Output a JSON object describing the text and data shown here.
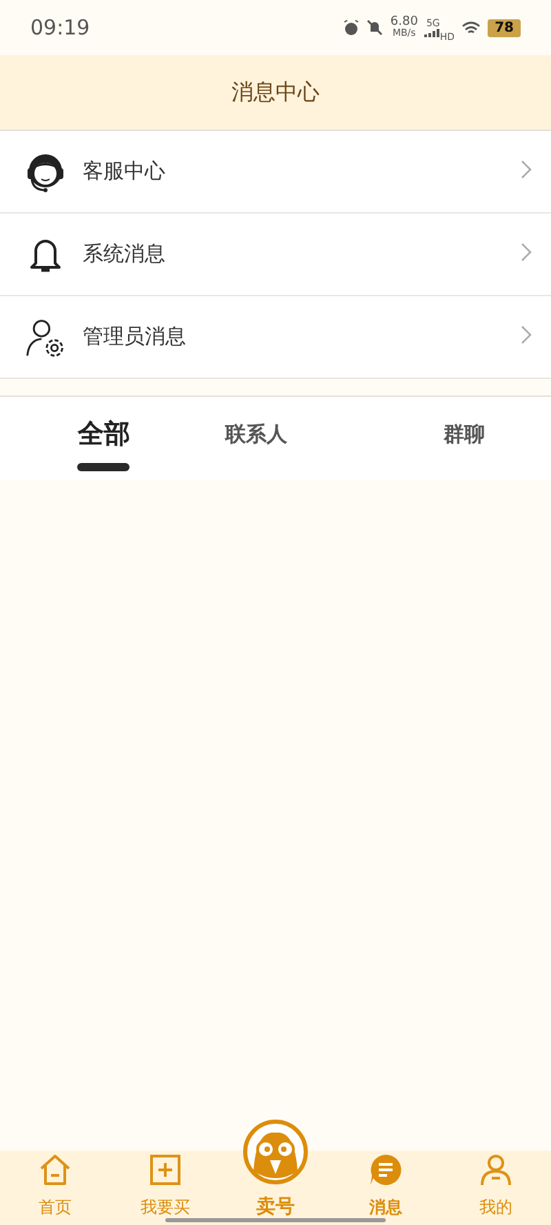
{
  "status_bar": {
    "time": "09:19",
    "speed": "6.80",
    "speed_unit": "MB/s",
    "network": "5G",
    "network_extra": "HD",
    "battery": "78"
  },
  "header": {
    "title": "消息中心"
  },
  "menu": [
    {
      "label": "客服中心"
    },
    {
      "label": "系统消息"
    },
    {
      "label": "管理员消息"
    }
  ],
  "tabs": [
    {
      "label": "全部",
      "selected": true
    },
    {
      "label": "联系人",
      "selected": false
    },
    {
      "label": "群聊",
      "selected": false
    }
  ],
  "bottom_nav": [
    {
      "label": "首页",
      "kind": "tab",
      "selected": false
    },
    {
      "label": "我要买",
      "kind": "tab",
      "selected": false
    },
    {
      "label": "卖号",
      "kind": "center"
    },
    {
      "label": "消息",
      "kind": "tab",
      "selected": true
    },
    {
      "label": "我的",
      "kind": "tab",
      "selected": false
    }
  ]
}
